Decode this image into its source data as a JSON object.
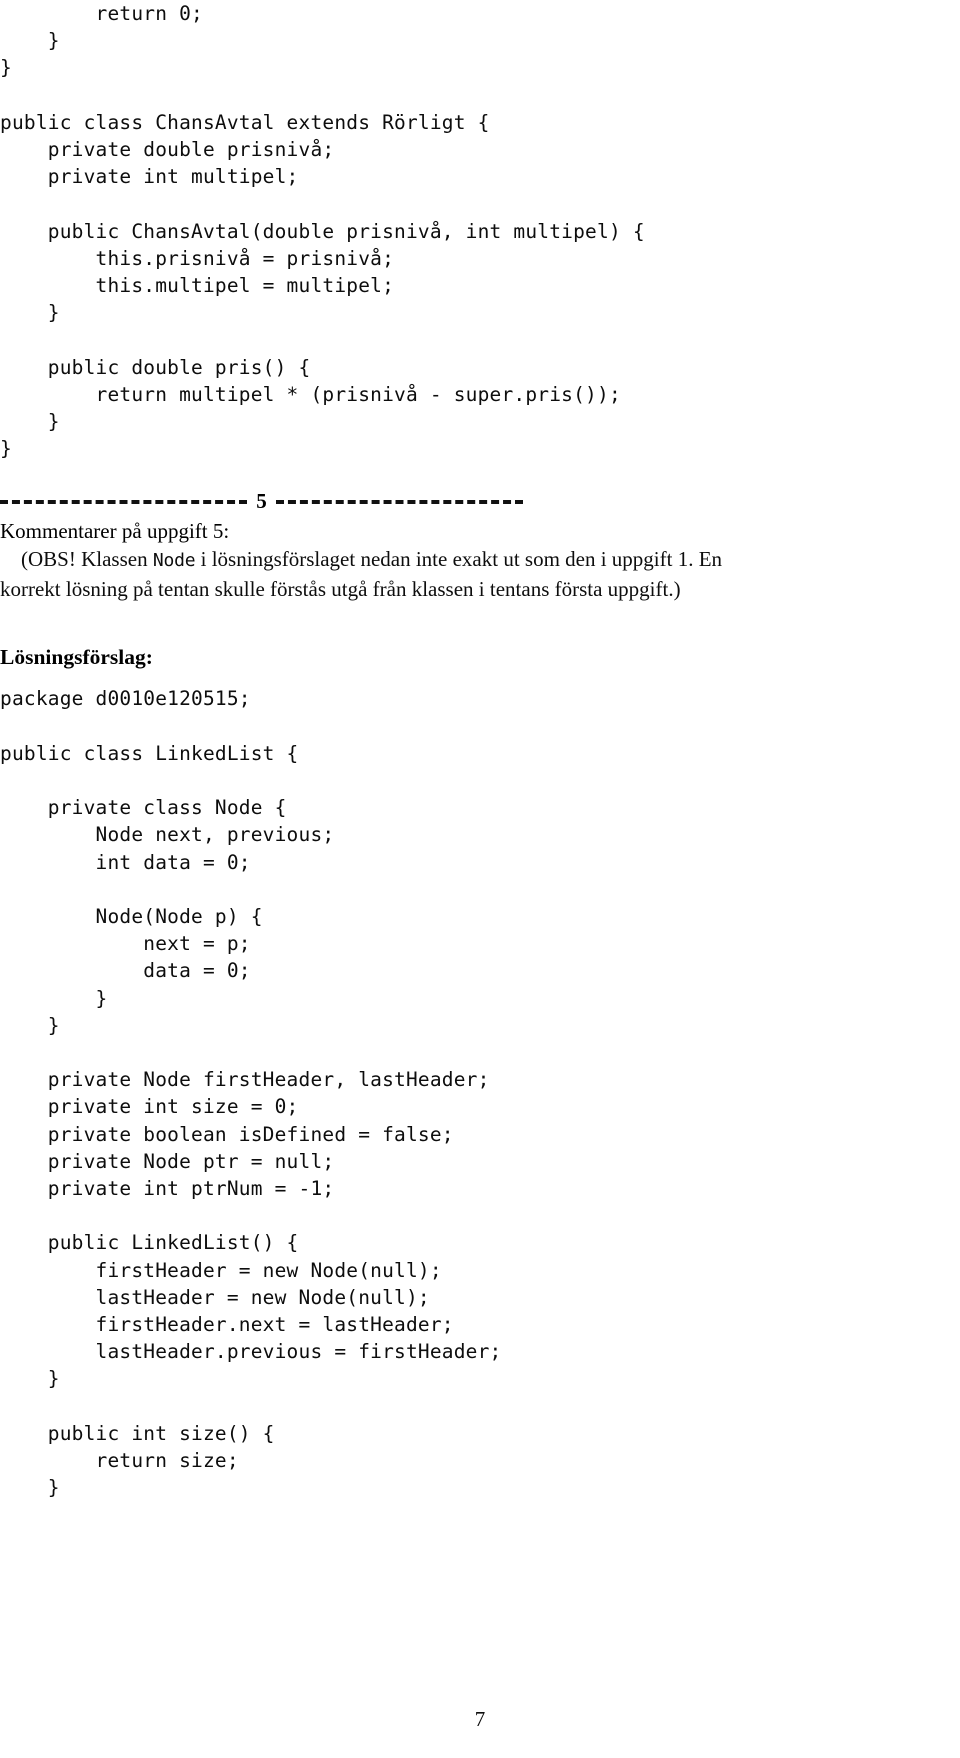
{
  "document": {
    "page_number": "7",
    "section_marker": "5"
  },
  "code_block_top": {
    "lines": [
      "        return 0;",
      "    }",
      "}",
      "",
      "public class ChansAvtal extends Rörligt {",
      "    private double prisnivå;",
      "    private int multipel;",
      "",
      "    public ChansAvtal(double prisnivå, int multipel) {",
      "        this.prisnivå = prisnivå;",
      "        this.multipel = multipel;",
      "    }",
      "",
      "    public double pris() {",
      "        return multipel * (prisnivå - super.pris());",
      "    }",
      "}"
    ]
  },
  "comments_section": {
    "heading": "Kommentarer på uppgift 5:",
    "note_line_1_before_mono": "    (OBS! Klassen ",
    "note_mono_word": "Node",
    "note_line_1_after_mono": " i lösningsförslaget nedan inte exakt ut som den i uppgift 1. En",
    "note_line_2": "korrekt lösning på tentan skulle förstås utgå från klassen i tentans första uppgift.)"
  },
  "solution": {
    "heading": "Lösningsförslag:",
    "lines": [
      "package d0010e120515;",
      "",
      "public class LinkedList {",
      "",
      "    private class Node {",
      "        Node next, previous;",
      "        int data = 0;",
      "",
      "        Node(Node p) {",
      "            next = p;",
      "            data = 0;",
      "        }",
      "    }",
      "",
      "    private Node firstHeader, lastHeader;",
      "    private int size = 0;",
      "    private boolean isDefined = false;",
      "    private Node ptr = null;",
      "    private int ptrNum = -1;",
      "",
      "    public LinkedList() {",
      "        firstHeader = new Node(null);",
      "        lastHeader = new Node(null);",
      "        firstHeader.next = lastHeader;",
      "        lastHeader.previous = firstHeader;",
      "    }",
      "",
      "    public int size() {",
      "        return size;",
      "    }"
    ]
  }
}
